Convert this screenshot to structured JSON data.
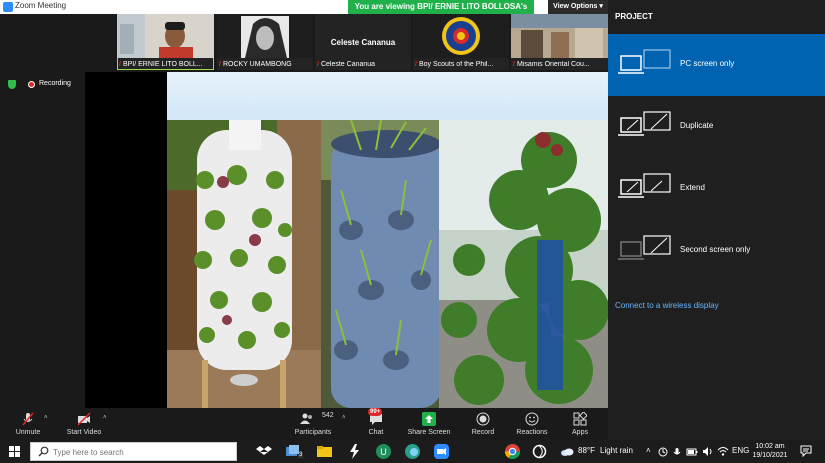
{
  "window": {
    "title": "Zoom Meeting"
  },
  "banner": {
    "text": "You are viewing BPI/ ERNIE LITO BOLLOSA's screen"
  },
  "view_options": {
    "label": "View Options",
    "caret": "▾"
  },
  "participants_strip": [
    {
      "name": "BPI/ ERNIE LITO BOLL...",
      "active": true,
      "kind": "video"
    },
    {
      "name": "ROCKY UMAMBONG",
      "kind": "photo"
    },
    {
      "name": "Celeste Cananua",
      "kind": "text",
      "big_name": "Celeste Cananua"
    },
    {
      "name": "Boy Scouts of the Phil...",
      "kind": "logo"
    },
    {
      "name": "Misamis Oriental Cou...",
      "kind": "photo"
    }
  ],
  "recording": {
    "label": "Recording"
  },
  "toolbar": {
    "unmute": "Unmute",
    "start_video": "Start Video",
    "participants": "Participants",
    "participants_count": "542",
    "chat": "Chat",
    "chat_badge": "99+",
    "share_screen": "Share Screen",
    "record": "Record",
    "reactions": "Reactions",
    "apps": "Apps",
    "caret": "˄"
  },
  "project_panel": {
    "title": "PROJECT",
    "options": [
      {
        "label": "PC screen only",
        "selected": true,
        "icon": "pc-screen-only-icon"
      },
      {
        "label": "Duplicate",
        "selected": false,
        "icon": "duplicate-icon"
      },
      {
        "label": "Extend",
        "selected": false,
        "icon": "extend-icon"
      },
      {
        "label": "Second screen only",
        "selected": false,
        "icon": "second-screen-only-icon"
      }
    ],
    "wireless_link": "Connect to a wireless display"
  },
  "taskbar": {
    "search_placeholder": "Type here to search",
    "dropbox_badge": "3",
    "weather_temp": "88°F",
    "weather_text": "Light rain",
    "language": "ENG",
    "time": "10:02 am",
    "date": "19/10/2021"
  },
  "colors": {
    "zoom_green": "#21b14b",
    "project_selected": "#0063b1",
    "link_blue": "#65b6ff",
    "recording_red": "#e02828"
  }
}
